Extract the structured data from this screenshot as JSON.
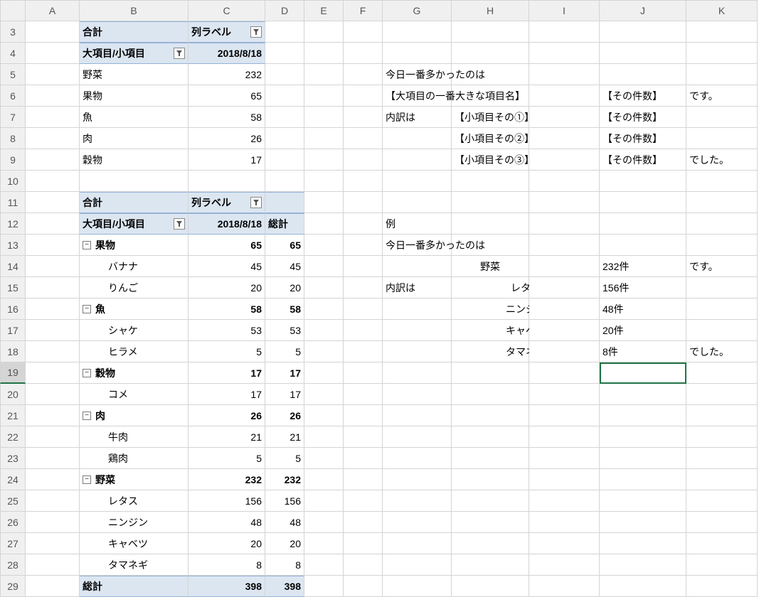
{
  "columns": [
    "A",
    "B",
    "C",
    "D",
    "E",
    "F",
    "G",
    "H",
    "I",
    "J",
    "K"
  ],
  "rowStart": 3,
  "rowEnd": 29,
  "selectedRow": 19,
  "selectedCol": "J",
  "pivot1": {
    "headerTotal": "合計",
    "headerColLabel": "列ラベル",
    "headerRowLabel": "大項目/小項目",
    "date": "2018/8/18",
    "rows": [
      {
        "label": "野菜",
        "val": 232
      },
      {
        "label": "果物",
        "val": 65
      },
      {
        "label": "魚",
        "val": 58
      },
      {
        "label": "肉",
        "val": 26
      },
      {
        "label": "穀物",
        "val": 17
      }
    ]
  },
  "pivot2": {
    "headerTotal": "合計",
    "headerColLabel": "列ラベル",
    "headerRowLabel": "大項目/小項目",
    "date": "2018/8/18",
    "totalLabel": "総計",
    "groups": [
      {
        "label": "果物",
        "val": 65,
        "tot": 65,
        "items": [
          {
            "label": "バナナ",
            "val": 45,
            "tot": 45
          },
          {
            "label": "りんご",
            "val": 20,
            "tot": 20
          }
        ]
      },
      {
        "label": "魚",
        "val": 58,
        "tot": 58,
        "items": [
          {
            "label": "シャケ",
            "val": 53,
            "tot": 53
          },
          {
            "label": "ヒラメ",
            "val": 5,
            "tot": 5
          }
        ]
      },
      {
        "label": "穀物",
        "val": 17,
        "tot": 17,
        "items": [
          {
            "label": "コメ",
            "val": 17,
            "tot": 17
          }
        ]
      },
      {
        "label": "肉",
        "val": 26,
        "tot": 26,
        "items": [
          {
            "label": "牛肉",
            "val": 21,
            "tot": 21
          },
          {
            "label": "鶏肉",
            "val": 5,
            "tot": 5
          }
        ]
      },
      {
        "label": "野菜",
        "val": 232,
        "tot": 232,
        "items": [
          {
            "label": "レタス",
            "val": 156,
            "tot": 156
          },
          {
            "label": "ニンジン",
            "val": 48,
            "tot": 48
          },
          {
            "label": "キャベツ",
            "val": 20,
            "tot": 20
          },
          {
            "label": "タマネギ",
            "val": 8,
            "tot": 8
          }
        ]
      }
    ],
    "grandTotal": {
      "label": "総計",
      "val": 398,
      "tot": 398
    }
  },
  "template": {
    "line1": "今日一番多かったのは",
    "line2a": "【大項目の一番大きな項目名】",
    "line2b": "【その件数】",
    "line2c": "です。",
    "line3a": "内訳は",
    "line3b": "【小項目その①】",
    "line3c": "【その件数】",
    "line4b": "【小項目その②】",
    "line4c": "【その件数】",
    "line5b": "【小項目その③】",
    "line5c": "【その件数】",
    "line5d": "でした。"
  },
  "example": {
    "label": "例",
    "line1": "今日一番多かったのは",
    "bigItem": "野菜",
    "bigCount": "232件",
    "desu": "です。",
    "breakdown": "内訳は",
    "items": [
      {
        "name": "レタス",
        "count": "156件"
      },
      {
        "name": "ニンジン",
        "count": "48件"
      },
      {
        "name": "キャベツ",
        "count": "20件"
      },
      {
        "name": "タマネギ",
        "count": "8件"
      }
    ],
    "deshita": "でした。"
  }
}
